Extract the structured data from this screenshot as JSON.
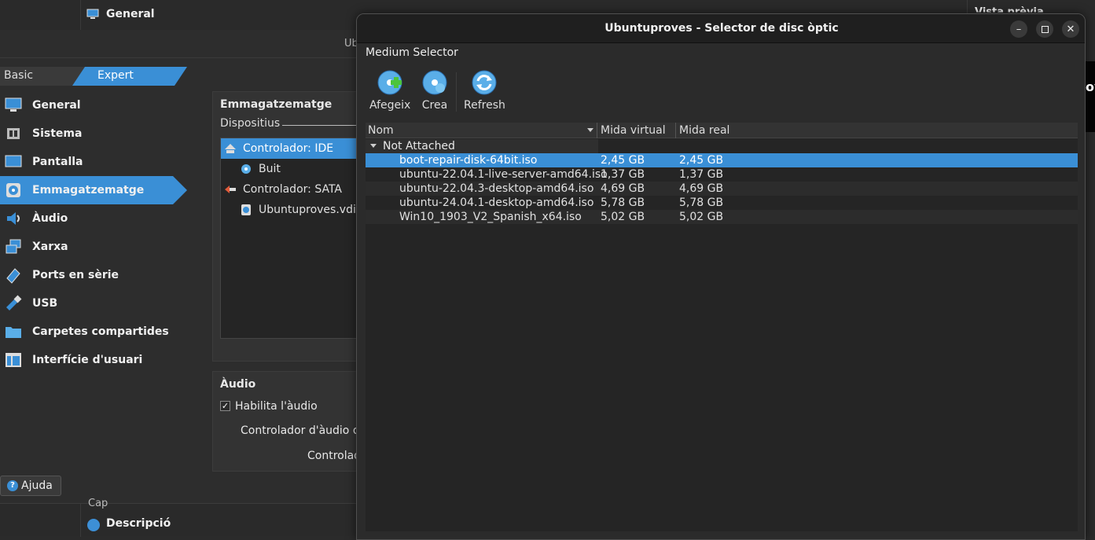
{
  "background": {
    "general_header": "General",
    "vista_label": "Vista prèvia",
    "settings_title_fragment": "Ub",
    "cap_label": "Cap",
    "description_label": "Descripció",
    "preview_fragment": "ov"
  },
  "settings": {
    "tabs": {
      "basic": "Basic",
      "expert": "Expert"
    },
    "sidebar": [
      {
        "label": "General",
        "icon": "monitor-icon"
      },
      {
        "label": "Sistema",
        "icon": "chip-icon"
      },
      {
        "label": "Pantalla",
        "icon": "display-icon"
      },
      {
        "label": "Emmagatzematge",
        "icon": "storage-disk-icon"
      },
      {
        "label": "Àudio",
        "icon": "speaker-icon"
      },
      {
        "label": "Xarxa",
        "icon": "network-icon"
      },
      {
        "label": "Ports en sèrie",
        "icon": "serial-port-icon"
      },
      {
        "label": "USB",
        "icon": "usb-icon"
      },
      {
        "label": "Carpetes compartides",
        "icon": "folder-icon"
      },
      {
        "label": "Interfície d'usuari",
        "icon": "window-icon"
      }
    ],
    "storage": {
      "title": "Emmagatzematge",
      "devices_label": "Dispositius",
      "tree": [
        {
          "label": "Controlador: IDE",
          "icon": "ide-controller-icon"
        },
        {
          "label": "Buit",
          "icon": "optical-disc-icon"
        },
        {
          "label": "Controlador: SATA",
          "icon": "sata-controller-icon"
        },
        {
          "label": "Ubuntuproves.vdi",
          "icon": "hard-disk-icon"
        }
      ]
    },
    "audio": {
      "title": "Àudio",
      "enable_label": "Habilita l'àudio",
      "controller_label": "Controlador d'àudio d",
      "controller_label2": "Controlad"
    },
    "help_label": "Ajuda"
  },
  "dialog": {
    "title": "Ubuntuproves - Selector de disc òptic",
    "menu": "Medium Selector",
    "toolbar": {
      "add": "Afegeix",
      "create": "Crea",
      "refresh": "Refresh"
    },
    "columns": {
      "name": "Nom",
      "virtual_size": "Mida virtual",
      "real_size": "Mida real"
    },
    "group": "Not Attached",
    "rows": [
      {
        "name": "boot-repair-disk-64bit.iso",
        "virtual": "2,45 GB",
        "real": "2,45 GB"
      },
      {
        "name": "ubuntu-22.04.1-live-server-amd64.iso",
        "virtual": "1,37 GB",
        "real": "1,37 GB"
      },
      {
        "name": "ubuntu-22.04.3-desktop-amd64.iso",
        "virtual": "4,69 GB",
        "real": "4,69 GB"
      },
      {
        "name": "ubuntu-24.04.1-desktop-amd64.iso",
        "virtual": "5,78 GB",
        "real": "5,78 GB"
      },
      {
        "name": "Win10_1903_V2_Spanish_x64.iso",
        "virtual": "5,02 GB",
        "real": "5,02 GB"
      }
    ],
    "selected_row": 0
  },
  "colors": {
    "accent": "#3a8fd6",
    "background": "#2b2b2b",
    "titlebar": "#1f1f1f"
  }
}
